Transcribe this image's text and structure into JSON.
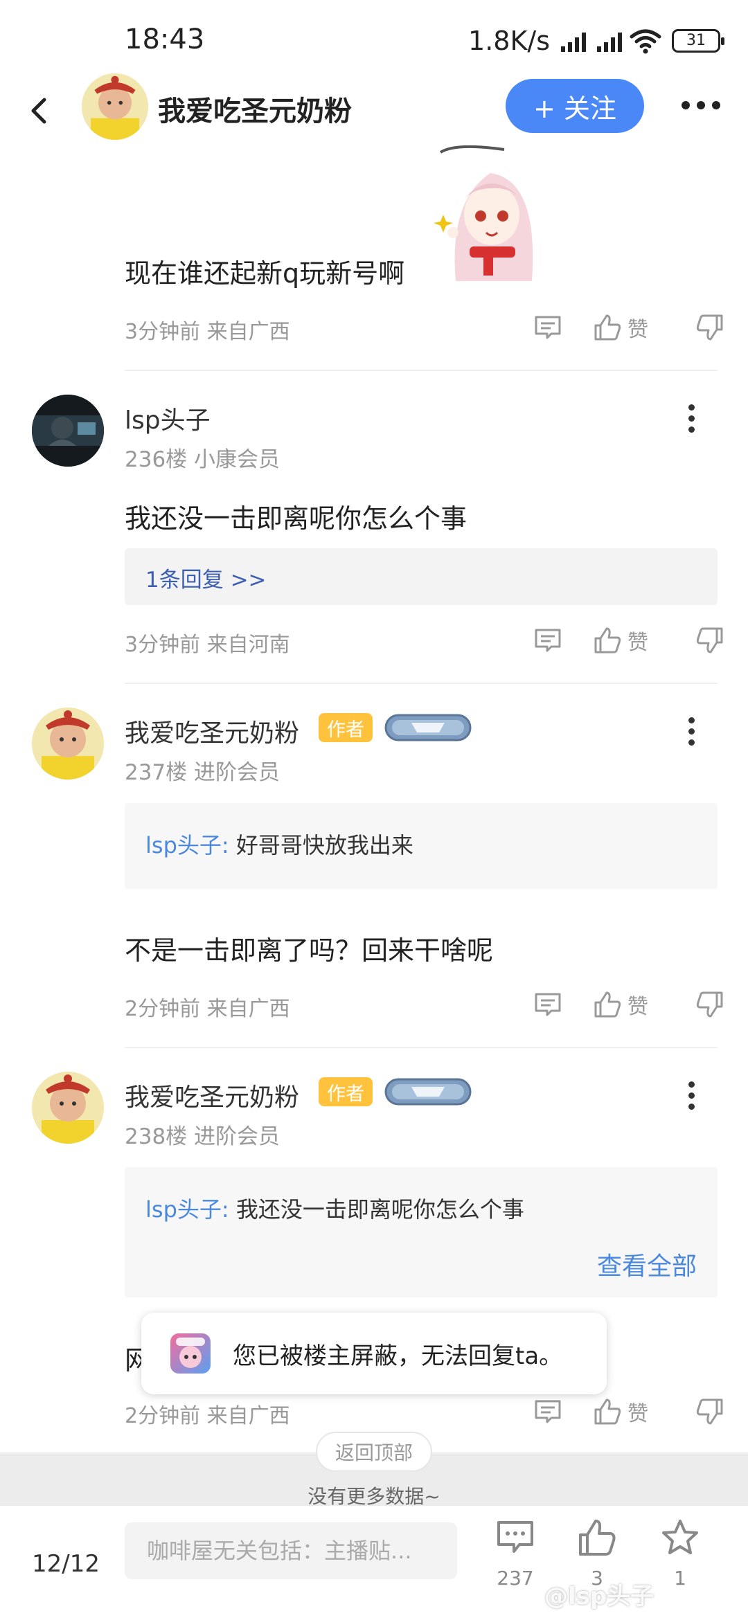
{
  "status_bar": {
    "time": "18:43",
    "net_speed": "1.8K/s",
    "battery": "31",
    "icons": [
      "hd-signal-icon",
      "hd-signal-icon",
      "wifi-icon",
      "battery-icon"
    ]
  },
  "header": {
    "title": "我爱吃圣元奶粉",
    "follow_label": "+ 关注",
    "icons": [
      "back-arrow-icon",
      "more-horizontal-icon"
    ]
  },
  "posts": [
    {
      "text": "现在谁还起新q玩新号啊",
      "time_location": "3分钟前 来自广西",
      "like_label": "赞"
    },
    {
      "username": "lsp头子",
      "floor_member": "236楼 小康会员",
      "text": "我还没一击即离呢你怎么个事",
      "reply_count": "1条回复 >>",
      "time_location": "3分钟前 来自河南",
      "like_label": "赞"
    },
    {
      "username": "我爱吃圣元奶粉",
      "author_badge": "作者",
      "floor_member": "237楼 进阶会员",
      "quote_name": "lsp头子:",
      "quote_text": "好哥哥快放我出来",
      "text": "不是一击即离了吗？回来干啥呢",
      "time_location": "2分钟前 来自广西",
      "like_label": "赞"
    },
    {
      "username": "我爱吃圣元奶粉",
      "author_badge": "作者",
      "floor_member": "238楼 进阶会员",
      "quote_name": "lsp头子:",
      "quote_text": "我还没一击即离呢你怎么个事",
      "view_all": "查看全部",
      "text_partial": "网",
      "time_location": "2分钟前 来自广西",
      "like_label": "赞"
    }
  ],
  "toast": {
    "text": "您已被楼主屏蔽，无法回复ta。"
  },
  "back_to_top": "返回顶部",
  "no_more_data": "没有更多数据~",
  "bottom_bar": {
    "page": "12/12",
    "input_placeholder": "咖啡屋无关包括：主播贴...",
    "comment_count": "237",
    "like_count": "3",
    "favorite_count": "1"
  },
  "watermark": "@lsp头子",
  "colors": {
    "accent_blue": "#4a88f7",
    "link_blue": "#4a88dd",
    "author_badge": "#ffc23d",
    "meta_gray": "#999999"
  }
}
